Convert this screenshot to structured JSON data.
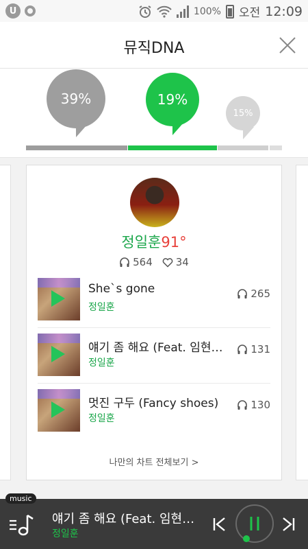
{
  "status": {
    "battery": "100%",
    "ampm": "오전",
    "time": "12:09",
    "app_icon_letter": "U"
  },
  "header": {
    "title": "뮤직DNA"
  },
  "bubbles": [
    {
      "label": "39%",
      "value": 0.39,
      "color": "#9e9e9e"
    },
    {
      "label": "19%",
      "value": 0.19,
      "color": "#1ec34a"
    },
    {
      "label": "15%",
      "value": 0.15,
      "color": "#d6d6d6"
    }
  ],
  "card": {
    "artist": "정일훈",
    "temperature": "91°",
    "listens": "564",
    "likes": "34",
    "songs": [
      {
        "title": "She`s gone",
        "artist": "정일훈",
        "plays": "265"
      },
      {
        "title": "얘기 좀 해요 (Feat. 임현식 Of 비투비)",
        "artist": "정일훈",
        "plays": "131"
      },
      {
        "title": "멋진 구두 (Fancy shoes)",
        "artist": "정일훈",
        "plays": "130"
      }
    ],
    "more_link": "나만의 차트 전체보기 >"
  },
  "player": {
    "badge": "music",
    "title": "얘기 좀 해요 (Feat. 임현식 Of 비투비)",
    "artist": "정일훈",
    "progress": 0.03
  },
  "colors": {
    "accent": "#1ec34a",
    "temperature": "#e8403a",
    "player_bg": "#3a3a3a"
  }
}
